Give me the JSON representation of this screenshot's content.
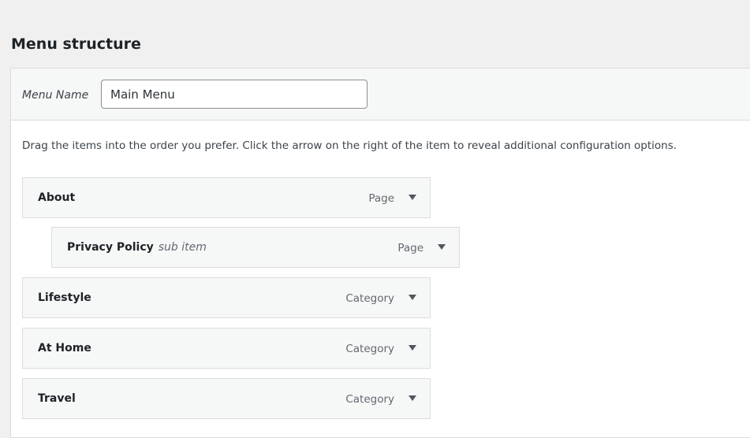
{
  "page": {
    "title": "Menu structure"
  },
  "menu_name": {
    "label": "Menu Name",
    "value": "Main Menu"
  },
  "instructions": "Drag the items into the order you prefer. Click the arrow on the right of the item to reveal additional configuration options.",
  "menu_items": [
    {
      "title": "About",
      "subtitle": "",
      "type": "Page",
      "depth": 0
    },
    {
      "title": "Privacy Policy",
      "subtitle": "sub item",
      "type": "Page",
      "depth": 1
    },
    {
      "title": "Lifestyle",
      "subtitle": "",
      "type": "Category",
      "depth": 0
    },
    {
      "title": "At Home",
      "subtitle": "",
      "type": "Category",
      "depth": 0
    },
    {
      "title": "Travel",
      "subtitle": "",
      "type": "Category",
      "depth": 0
    }
  ],
  "icons": {
    "item_toggle": "triangle-down-icon"
  },
  "colors": {
    "background": "#f0f0f1",
    "panel": "#ffffff",
    "item_background": "#f6f7f7",
    "border": "#dcdcde",
    "arrow": "#50575e"
  }
}
